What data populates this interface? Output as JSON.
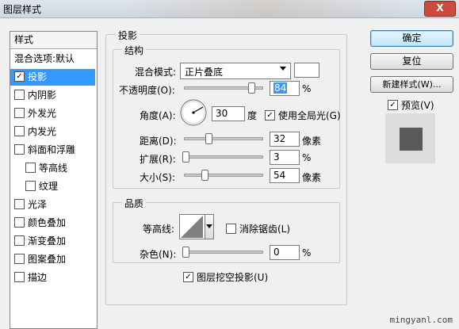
{
  "window": {
    "title": "图层样式",
    "close_label": "X"
  },
  "style_list": {
    "header": "样式",
    "blend_options": "混合选项:默认",
    "items": [
      {
        "label": "投影",
        "checked": true,
        "selected": true
      },
      {
        "label": "内阴影",
        "checked": false
      },
      {
        "label": "外发光",
        "checked": false
      },
      {
        "label": "内发光",
        "checked": false
      },
      {
        "label": "斜面和浮雕",
        "checked": false
      },
      {
        "label": "等高线",
        "checked": false
      },
      {
        "label": "纹理",
        "checked": false
      },
      {
        "label": "光泽",
        "checked": false
      },
      {
        "label": "颜色叠加",
        "checked": false
      },
      {
        "label": "渐变叠加",
        "checked": false
      },
      {
        "label": "图案叠加",
        "checked": false
      },
      {
        "label": "描边",
        "checked": false
      }
    ]
  },
  "drop_shadow": {
    "title": "投影",
    "structure": {
      "title": "结构",
      "blend_mode_label": "混合模式:",
      "blend_mode_value": "正片叠底",
      "shadow_color": "#ffffff",
      "opacity_label": "不透明度(O):",
      "opacity_value": "84",
      "opacity_unit": "%",
      "angle_label": "角度(A):",
      "angle_value": "30",
      "angle_unit": "度",
      "global_light_label": "使用全局光(G)",
      "global_light_checked": true,
      "distance_label": "距离(D):",
      "distance_value": "32",
      "distance_unit": "像素",
      "spread_label": "扩展(R):",
      "spread_value": "3",
      "spread_unit": "%",
      "size_label": "大小(S):",
      "size_value": "54",
      "size_unit": "像素"
    },
    "quality": {
      "title": "品质",
      "contour_label": "等高线:",
      "antialiased_label": "消除锯齿(L)",
      "antialiased_checked": false,
      "noise_label": "杂色(N):",
      "noise_value": "0",
      "noise_unit": "%"
    },
    "knockout_label": "图层挖空投影(U)",
    "knockout_checked": true
  },
  "buttons": {
    "ok": "确定",
    "reset": "复位",
    "new_style": "新建样式(W)...",
    "preview_label": "预览(V)",
    "preview_checked": true
  },
  "watermark": "mingyanl.com"
}
